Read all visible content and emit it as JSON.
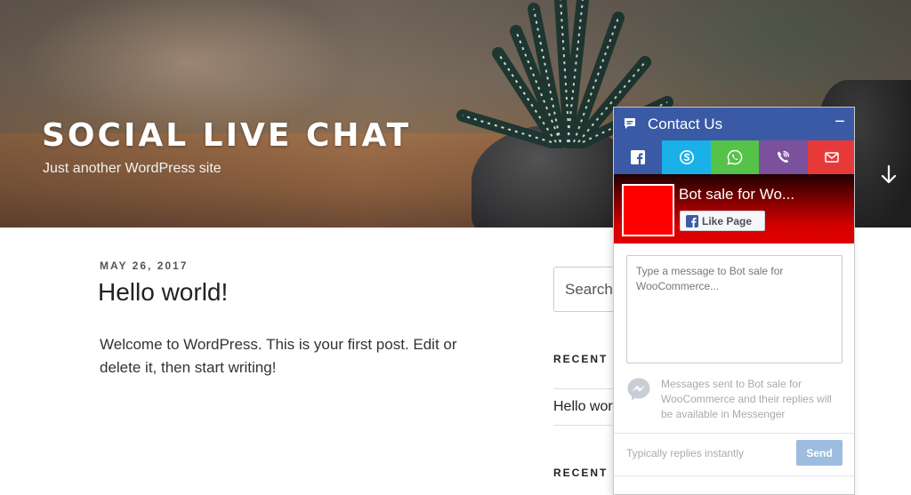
{
  "site": {
    "title": "SOCIAL LIVE CHAT",
    "description": "Just another WordPress site"
  },
  "post": {
    "date": "MAY 26, 2017",
    "title": "Hello world!",
    "body": "Welcome to WordPress. This is your first post. Edit or delete it, then start writing!"
  },
  "sidebar": {
    "search_placeholder": "Search",
    "widget1_title": "RECENT",
    "recent_link": "Hello wor",
    "widget2_title": "RECENT"
  },
  "chat": {
    "header_title": "Contact Us",
    "minimize_label": "−",
    "tabs": [
      {
        "name": "facebook-icon",
        "color": "#3b5aa6"
      },
      {
        "name": "skype-icon",
        "color": "#1ab0e8"
      },
      {
        "name": "whatsapp-icon",
        "color": "#55c24a"
      },
      {
        "name": "viber-icon",
        "color": "#7b519d"
      },
      {
        "name": "email-icon",
        "color": "#e63a3a"
      }
    ],
    "page_name": "Bot sale for Wo...",
    "like_label": "Like Page",
    "message_placeholder": "Type a message to Bot sale for WooCommerce...",
    "notice": "Messages sent to Bot sale for WooCommerce and their replies will be available in Messenger",
    "replies_text": "Typically replies instantly",
    "send_label": "Send"
  },
  "colors": {
    "header": "#3b5aa6",
    "send_button": "#9dbde0",
    "banner_red": "#e00000"
  }
}
